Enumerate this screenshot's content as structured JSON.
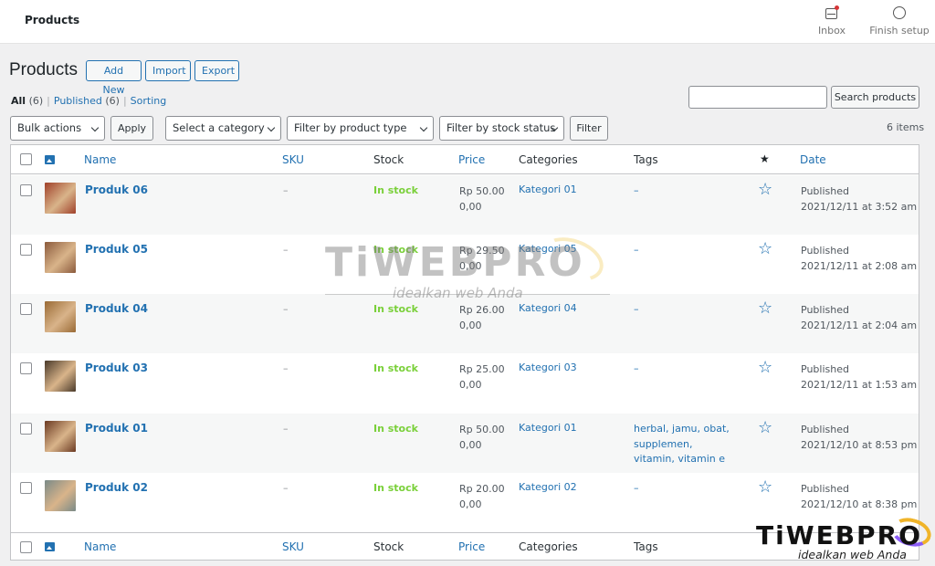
{
  "topbar": {
    "title": "Products",
    "inbox_label": "Inbox",
    "finish_label": "Finish setup"
  },
  "header": {
    "title": "Products",
    "add_new": "Add New",
    "import": "Import",
    "export": "Export"
  },
  "views": {
    "all": "All",
    "all_count": "(6)",
    "published": "Published",
    "published_count": "(6)",
    "sorting": "Sorting",
    "separator": "|"
  },
  "search": {
    "placeholder": "",
    "button": "Search products"
  },
  "filters": {
    "bulk_actions": "Bulk actions",
    "apply": "Apply",
    "category": "Select a category",
    "product_type": "Filter by product type",
    "stock_status": "Filter by stock status",
    "filter": "Filter",
    "items_count": "6 items"
  },
  "columns": {
    "name": "Name",
    "sku": "SKU",
    "stock": "Stock",
    "price": "Price",
    "categories": "Categories",
    "tags": "Tags",
    "date": "Date",
    "featured_icon": "star-icon"
  },
  "products": [
    {
      "name": "Produk 06",
      "sku": "–",
      "stock": "In stock",
      "price": "Rp 50.00",
      "price_sub": "0,00",
      "category": "Kategori 01",
      "tags": "–",
      "status": "Published",
      "date": "2021/12/11 at 3:52 am",
      "thumb": "#a0412a"
    },
    {
      "name": "Produk 05",
      "sku": "–",
      "stock": "In stock",
      "price": "Rp 29.50",
      "price_sub": "0,00",
      "category": "Kategori 05",
      "tags": "–",
      "status": "Published",
      "date": "2021/12/11 at 2:08 am",
      "thumb": "#8b5a3c"
    },
    {
      "name": "Produk 04",
      "sku": "–",
      "stock": "In stock",
      "price": "Rp 26.00",
      "price_sub": "0,00",
      "category": "Kategori 04",
      "tags": "–",
      "status": "Published",
      "date": "2021/12/11 at 2:04 am",
      "thumb": "#9a6a35"
    },
    {
      "name": "Produk 03",
      "sku": "–",
      "stock": "In stock",
      "price": "Rp 25.00",
      "price_sub": "0,00",
      "category": "Kategori 03",
      "tags": "–",
      "status": "Published",
      "date": "2021/12/11 at 1:53 am",
      "thumb": "#4a3a2a"
    },
    {
      "name": "Produk 01",
      "sku": "–",
      "stock": "In stock",
      "price": "Rp 50.00",
      "price_sub": "0,00",
      "category": "Kategori 01",
      "tags": "herbal, jamu, obat, supplemen, vitamin, vitamin e",
      "status": "Published",
      "date": "2021/12/10 at 8:53 pm",
      "thumb": "#6b3a22"
    },
    {
      "name": "Produk 02",
      "sku": "–",
      "stock": "In stock",
      "price": "Rp 20.00",
      "price_sub": "0,00",
      "category": "Kategori 02",
      "tags": "–",
      "status": "Published",
      "date": "2021/12/10 at 8:38 pm",
      "thumb": "#7a8a88"
    }
  ],
  "watermark": {
    "brand": "TiWEBPRO",
    "tagline": "idealkan web Anda"
  }
}
